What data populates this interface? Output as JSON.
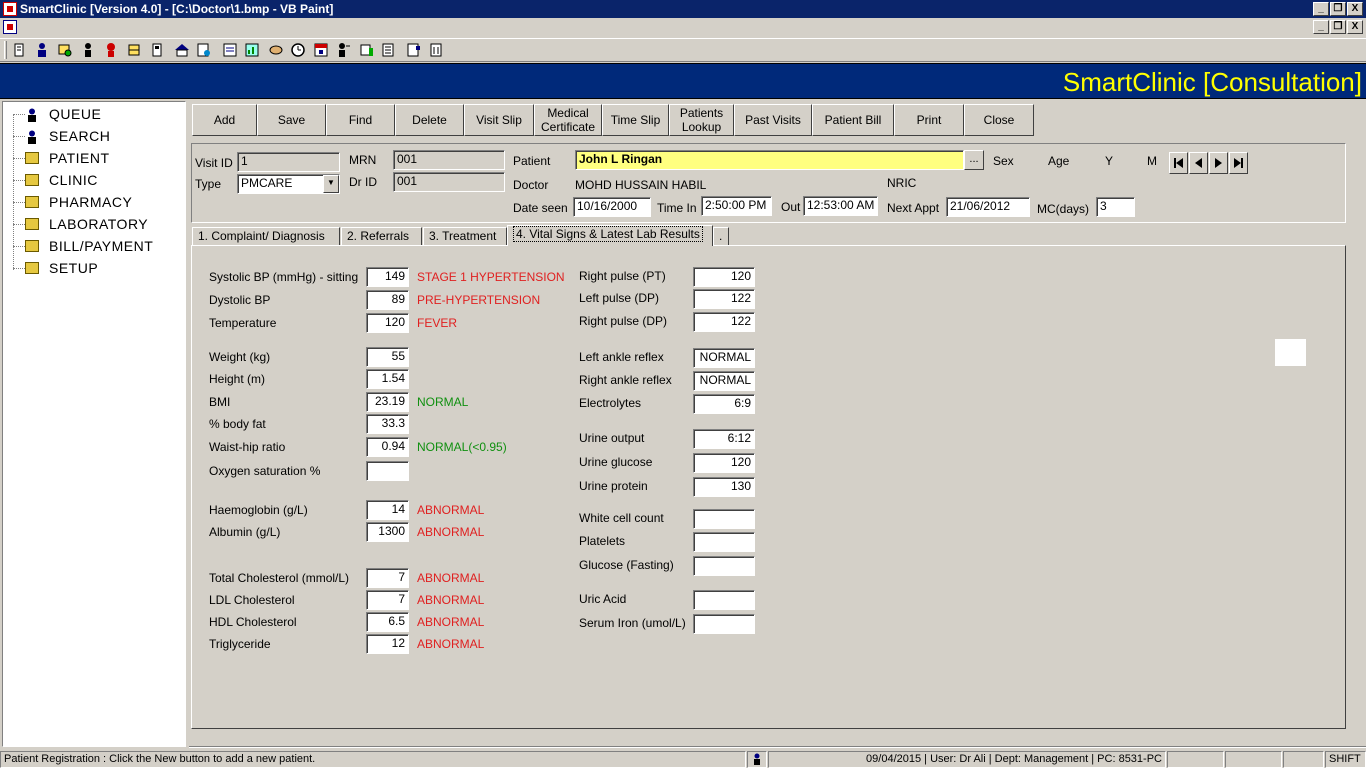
{
  "window": {
    "title": "SmartClinic [Version 4.0] - [C:\\Doctor\\1.bmp - VB Paint]",
    "controls": [
      "_",
      "1",
      "X"
    ]
  },
  "banner": {
    "title": "SmartClinic [Consultation]"
  },
  "tree": {
    "items": [
      {
        "label": "QUEUE",
        "icon": "person-icon"
      },
      {
        "label": "SEARCH",
        "icon": "person-icon"
      },
      {
        "label": "PATIENT",
        "icon": "folder-icon"
      },
      {
        "label": "CLINIC",
        "icon": "folder-icon"
      },
      {
        "label": "PHARMACY",
        "icon": "folder-icon"
      },
      {
        "label": "LABORATORY",
        "icon": "folder-icon"
      },
      {
        "label": "BILL/PAYMENT",
        "icon": "folder-icon"
      },
      {
        "label": "SETUP",
        "icon": "folder-icon"
      }
    ]
  },
  "commands": {
    "add": "Add",
    "save": "Save",
    "find": "Find",
    "delete": "Delete",
    "visit_slip": "Visit Slip",
    "medical_certificate_1": "Medical",
    "medical_certificate_2": "Certificate",
    "time_slip": "Time Slip",
    "patients_lookup_1": "Patients",
    "patients_lookup_2": "Lookup",
    "past_visits": "Past Visits",
    "patient_bill": "Patient Bill",
    "print": "Print",
    "close": "Close"
  },
  "info": {
    "visit_id_label": "Visit ID",
    "visit_id": "1",
    "type_label": "Type",
    "type": "PMCARE",
    "mrn_label": "MRN",
    "mrn": "001",
    "dr_id_label": "Dr ID",
    "dr_id": "001",
    "patient_label": "Patient",
    "patient": "John L Ringan",
    "lookup_button": "...",
    "sex_label": "Sex",
    "age_label": "Age",
    "y_label": "Y",
    "m_label": "M",
    "doctor_label": "Doctor",
    "doctor": "MOHD HUSSAIN HABIL",
    "nric_label": "NRIC",
    "date_seen_label": "Date seen",
    "date_seen": "10/16/2000",
    "time_in_label": "Time In",
    "time_in": "2:50:00 PM",
    "out_label": "Out",
    "out": "12:53:00 AM",
    "next_appt_label": "Next Appt",
    "next_appt": "21/06/2012",
    "mc_days_label": "MC(days)",
    "mc_days": "3"
  },
  "tabs": [
    {
      "label": "1. Complaint/ Diagnosis"
    },
    {
      "label": "2. Referrals"
    },
    {
      "label": "3. Treatment"
    },
    {
      "label": "4. Vital Signs & Latest Lab Results"
    },
    {
      "label": "."
    }
  ],
  "vitals_left": [
    {
      "label": "Systolic BP (mmHg) - sitting",
      "value": "149",
      "status": "STAGE 1 HYPERTENSION",
      "status_color": "#e02020"
    },
    {
      "label": "Dystolic BP",
      "value": "89",
      "status": "PRE-HYPERTENSION",
      "status_color": "#e02020"
    },
    {
      "label": "Temperature",
      "value": "120",
      "status": "FEVER",
      "status_color": "#e02020"
    },
    {
      "label": "Weight (kg)",
      "value": "55",
      "status": "",
      "status_color": ""
    },
    {
      "label": "Height (m)",
      "value": "1.54",
      "status": "",
      "status_color": ""
    },
    {
      "label": "BMI",
      "value": "23.19",
      "status": "NORMAL",
      "status_color": "#109010"
    },
    {
      "label": "% body fat",
      "value": "33.3",
      "status": "",
      "status_color": ""
    },
    {
      "label": "Waist-hip ratio",
      "value": "0.94",
      "status": "NORMAL(<0.95)",
      "status_color": "#109010"
    },
    {
      "label": "Oxygen saturation %",
      "value": "",
      "status": "",
      "status_color": ""
    },
    {
      "label": "Haemoglobin (g/L)",
      "value": "14",
      "status": "ABNORMAL",
      "status_color": "#e02020"
    },
    {
      "label": "Albumin (g/L)",
      "value": "1300",
      "status": "ABNORMAL",
      "status_color": "#e02020"
    },
    {
      "label": "Total Cholesterol (mmol/L)",
      "value": "7",
      "status": "ABNORMAL",
      "status_color": "#e02020"
    },
    {
      "label": "LDL Cholesterol",
      "value": "7",
      "status": "ABNORMAL",
      "status_color": "#e02020"
    },
    {
      "label": "HDL Cholesterol",
      "value": "6.5",
      "status": "ABNORMAL",
      "status_color": "#e02020"
    },
    {
      "label": "Triglyceride",
      "value": "12",
      "status": "ABNORMAL",
      "status_color": "#e02020"
    }
  ],
  "vitals_right": [
    {
      "label": "Right pulse (PT)",
      "value": "120"
    },
    {
      "label": "Left pulse (DP)",
      "value": "122"
    },
    {
      "label": "Right pulse (DP)",
      "value": "122"
    },
    {
      "label": "Left ankle reflex",
      "value": "NORMAL"
    },
    {
      "label": "Right ankle reflex",
      "value": "NORMAL"
    },
    {
      "label": "Electrolytes",
      "value": "6:9"
    },
    {
      "label": "Urine output",
      "value": "6:12"
    },
    {
      "label": "Urine glucose",
      "value": "120"
    },
    {
      "label": "Urine protein",
      "value": "130"
    },
    {
      "label": "White cell count",
      "value": ""
    },
    {
      "label": "Platelets",
      "value": ""
    },
    {
      "label": "Glucose (Fasting)",
      "value": ""
    },
    {
      "label": "Uric Acid",
      "value": ""
    },
    {
      "label": "Serum Iron (umol/L)",
      "value": ""
    }
  ],
  "status": {
    "message": "Patient Registration : Click the New button to add a new patient.",
    "info": "09/04/2015 | User: Dr Ali | Dept: Management | PC: 8531-PC",
    "shift": "SHIFT"
  }
}
